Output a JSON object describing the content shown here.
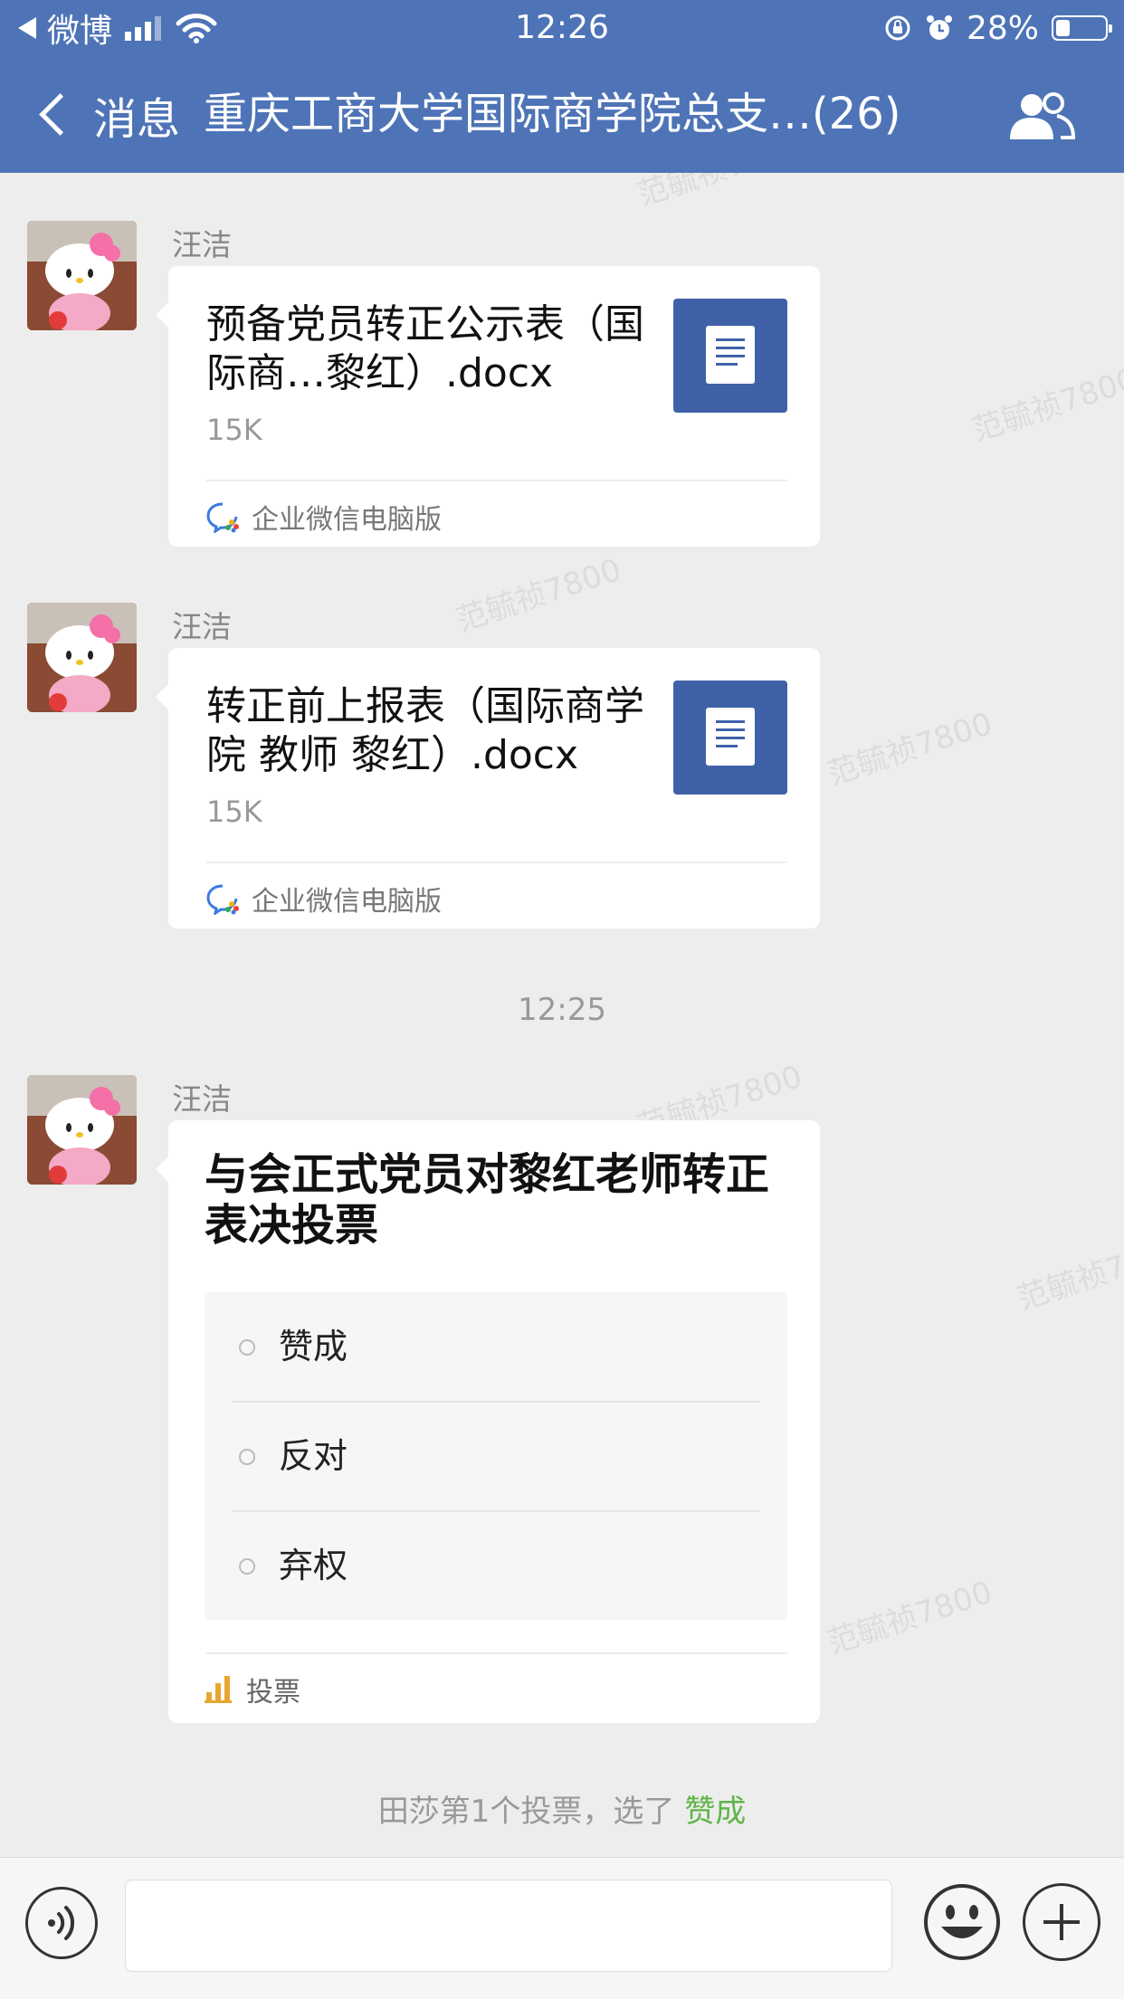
{
  "status_bar": {
    "back_app": "微博",
    "time": "12:26",
    "battery": "28%",
    "battery_level": 0.28
  },
  "nav": {
    "back_label": "消息",
    "title": "重庆工商大学国际商学院总支…(26)",
    "members_icon": "group-members-icon"
  },
  "messages": [
    {
      "sender": "汪洁",
      "file_name": "预备党员转正公示表（国际商…黎红）.docx",
      "file_size": "15K",
      "source": "企业微信电脑版"
    },
    {
      "sender": "汪洁",
      "file_name": "转正前上报表（国际商学院 教师 黎红）.docx",
      "file_size": "15K",
      "source": "企业微信电脑版"
    }
  ],
  "timestamp": "12:25",
  "vote_message": {
    "sender": "汪洁",
    "title": "与会正式党员对黎红老师转正表决投票",
    "options": [
      "赞成",
      "反对",
      "弃权"
    ],
    "footer_label": "投票"
  },
  "system_note": {
    "text": "田莎第1个投票，选了 ",
    "choice": "赞成",
    "choice_color": "#5fb548"
  },
  "watermark": "范毓祯7800",
  "colors": {
    "header": "#4e74b7",
    "file_icon": "#3f61a8"
  }
}
